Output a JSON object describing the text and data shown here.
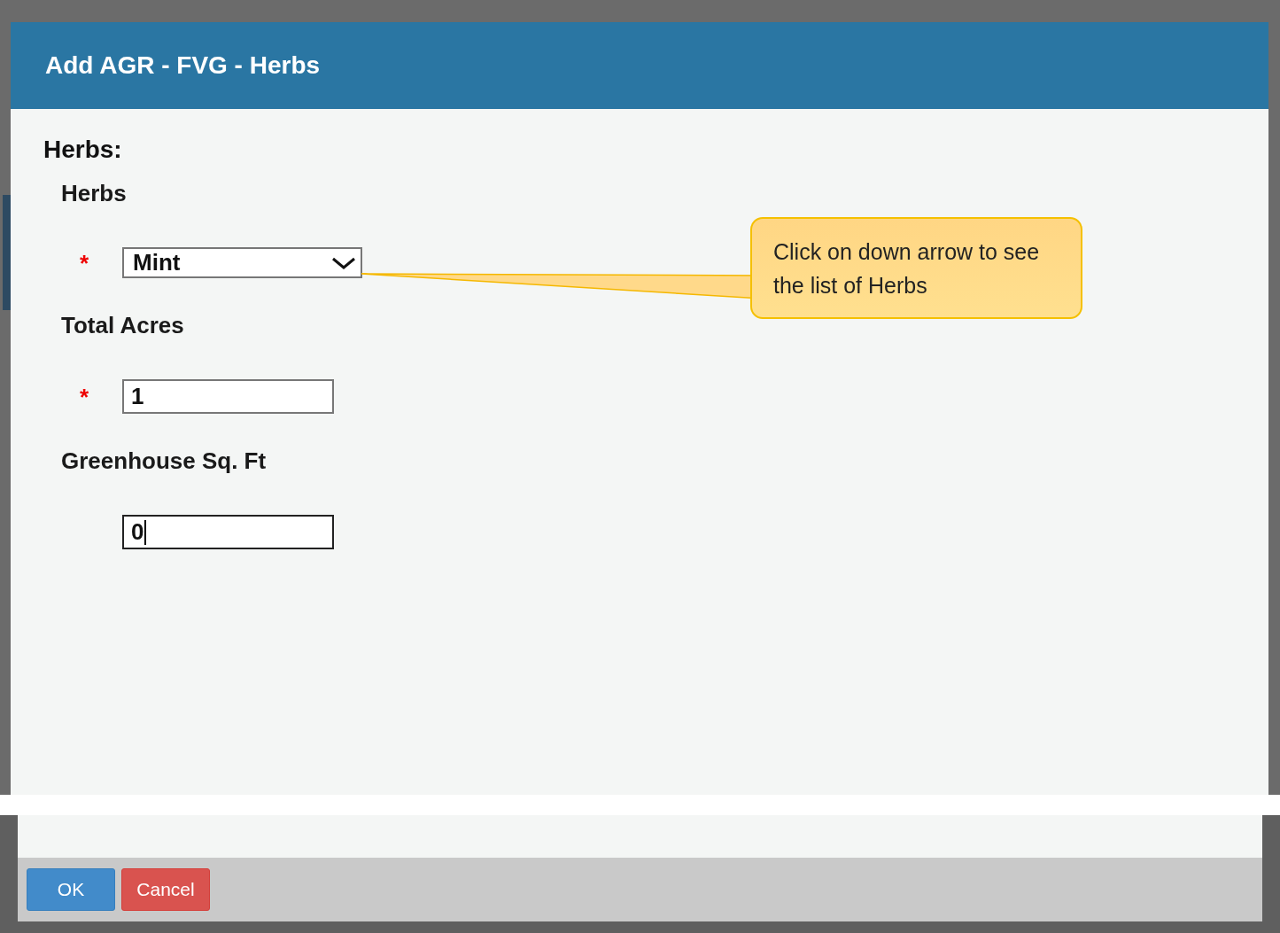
{
  "dialog": {
    "title": "Add AGR - FVG - Herbs"
  },
  "section_title": "Herbs:",
  "required_mark": "*",
  "fields": [
    {
      "label": "Herbs",
      "kind": "select",
      "required": true,
      "value": "Mint",
      "focused": false
    },
    {
      "label": "Total Acres",
      "kind": "text",
      "required": true,
      "value": "1",
      "focused": false
    },
    {
      "label": "Greenhouse Sq. Ft",
      "kind": "text",
      "required": false,
      "value": "0",
      "focused": true
    }
  ],
  "callout": {
    "text": "Click on down arrow to see the list of Herbs"
  },
  "buttons": [
    {
      "label": "OK",
      "kind": "primary"
    },
    {
      "label": "Cancel",
      "kind": "danger"
    }
  ]
}
